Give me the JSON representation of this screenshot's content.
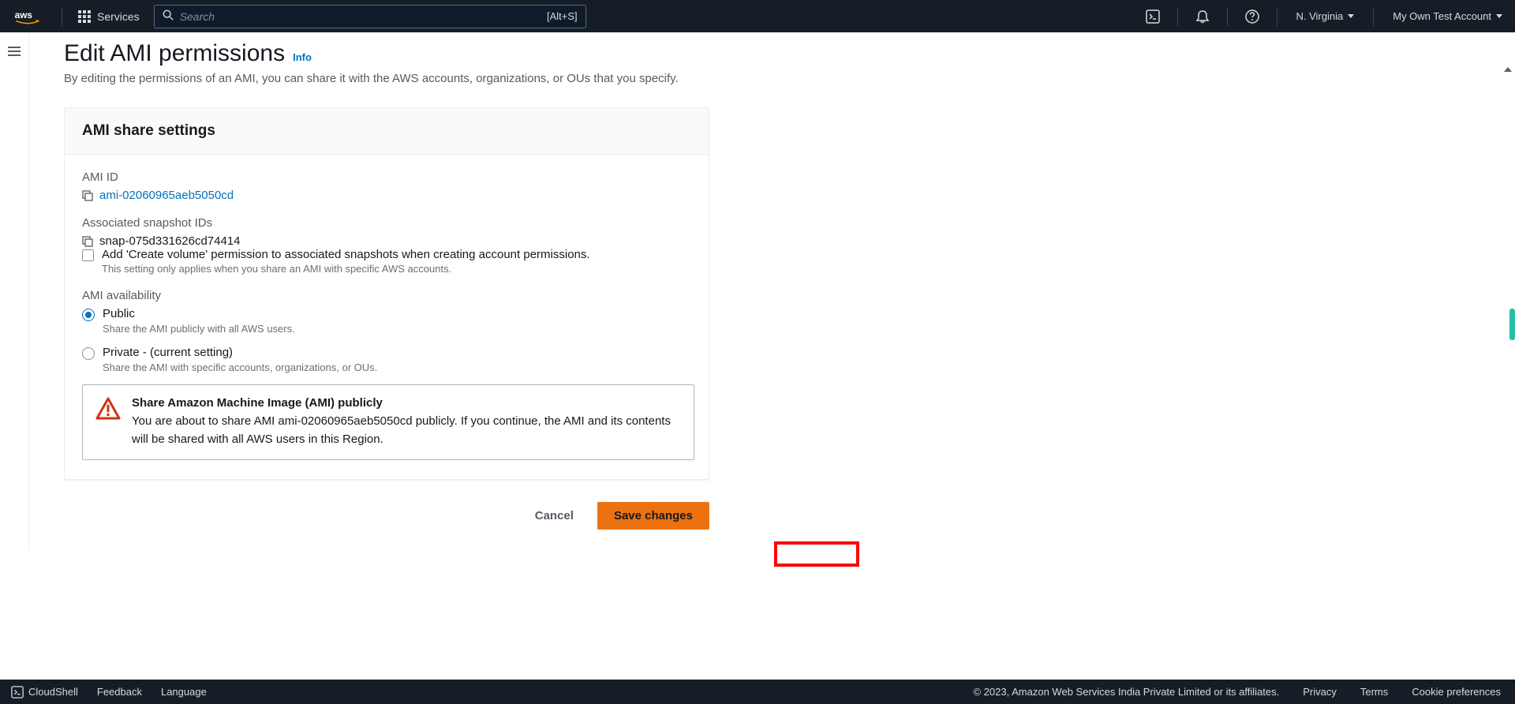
{
  "nav": {
    "services": "Services",
    "search_placeholder": "Search",
    "search_shortcut": "[Alt+S]",
    "region": "N. Virginia",
    "account": "My Own Test Account"
  },
  "page": {
    "title": "Edit AMI permissions",
    "info": "Info",
    "description": "By editing the permissions of an AMI, you can share it with the AWS accounts, organizations, or OUs that you specify."
  },
  "panel": {
    "title": "AMI share settings",
    "ami_id_label": "AMI ID",
    "ami_id": "ami-02060965aeb5050cd",
    "snapshot_label": "Associated snapshot IDs",
    "snapshot_id": "snap-075d331626cd74414",
    "checkbox_label": "Add 'Create volume' permission to associated snapshots when creating account permissions.",
    "checkbox_help": "This setting only applies when you share an AMI with specific AWS accounts.",
    "availability_label": "AMI availability",
    "options": {
      "public": {
        "label": "Public",
        "help": "Share the AMI publicly with all AWS users."
      },
      "private": {
        "label": "Private - (current setting)",
        "help": "Share the AMI with specific accounts, organizations, or OUs."
      }
    },
    "alert": {
      "title": "Share Amazon Machine Image (AMI) publicly",
      "body": "You are about to share AMI ami-02060965aeb5050cd publicly. If you continue, the AMI and its contents will be shared with all AWS users in this Region."
    }
  },
  "buttons": {
    "cancel": "Cancel",
    "save": "Save changes"
  },
  "footer": {
    "cloudshell": "CloudShell",
    "feedback": "Feedback",
    "language": "Language",
    "copyright": "© 2023, Amazon Web Services India Private Limited or its affiliates.",
    "privacy": "Privacy",
    "terms": "Terms",
    "cookies": "Cookie preferences"
  }
}
